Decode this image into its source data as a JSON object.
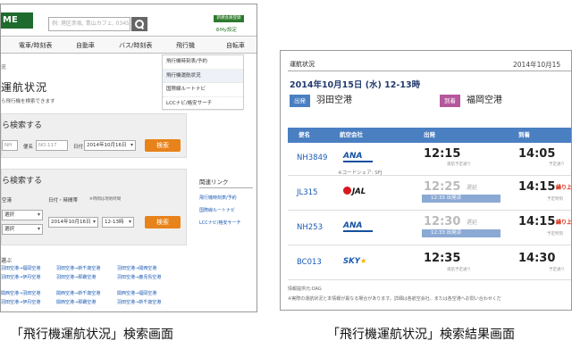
{
  "left": {
    "logo": "ME",
    "search_placeholder": "例: 港区赤坂, 青山カフェ, 0345678901",
    "top_right": "新規会員登録",
    "my_settings": "My設定",
    "nav": [
      "電車/時刻表",
      "自動車",
      "バス/時刻表",
      "飛行機",
      "自転車"
    ],
    "dropdown": [
      "飛行機時刻表/予約",
      "飛行機運航状況",
      "国際線ルートナビ",
      "LCCナビ/格安サーチ"
    ],
    "section_label": "況",
    "page_title": "運航状況",
    "page_sub": "ら飛行機を検索できます",
    "box1": {
      "title": "ら検索する",
      "field1_placeholder": "NH",
      "label_flight": "便名",
      "field2_placeholder": "NO.117",
      "label_date": "日付",
      "date_value": "2014年10月16日",
      "button": "検索"
    },
    "box2": {
      "title": "ら検索する",
      "label_departure": "空港",
      "label_datetime": "日付・時間帯",
      "note": "※時間は現地時間",
      "dep_value": "選択",
      "arr_value": "選択",
      "date_value": "2014年10月16日",
      "time_value": "12-13時",
      "button": "検索"
    },
    "related": {
      "title": "関連リンク",
      "links": [
        "飛行機時刻表/予約",
        "国際線ルートナビ",
        "LCCナビ/格安サーチ"
      ]
    },
    "routes_title": "選ぶ",
    "routes": [
      "羽田空港→福岡空港",
      "羽田空港→新千歳空港",
      "羽田空港→関西空港",
      "羽田空港→伊丹空港",
      "羽田空港→那覇空港",
      "羽田空港→鹿児島空港",
      "関西空港→羽田空港",
      "関西空港→新千歳空港",
      "関西空港→福岡空港",
      "羽田空港→伊丹空港",
      "関西空港→那覇空港",
      "羽田空港→新千歳空港"
    ]
  },
  "right": {
    "section_label": "運航状況",
    "date_top": "2014年10月15",
    "title": "2014年10月15日 (水) 12-13時",
    "dep_badge": "出発",
    "dep_airport": "羽田空港",
    "arr_badge": "到着",
    "arr_airport": "福岡空港",
    "headers": [
      "便名",
      "航空会社",
      "出発",
      "到着"
    ],
    "flights": [
      {
        "no": "NH3849",
        "airline": "ANA",
        "dep": "12:15",
        "dep_note": "運航予定通り",
        "arr": "14:05",
        "arr_note": "予定通り",
        "sub": "※コードシェア: SFJ"
      },
      {
        "no": "JL315",
        "airline": "JAL",
        "dep": "12:25",
        "dep_status": "遅延",
        "dep_bar": "12:33 出発済",
        "arr": "14:15",
        "arr_status": "繰り上",
        "arr_note": "予定時刻"
      },
      {
        "no": "NH253",
        "airline": "ANA",
        "dep": "12:30",
        "dep_status": "遅延",
        "dep_bar": "12:33 出発済",
        "arr": "14:15",
        "arr_status": "繰り上",
        "arr_note": "予定時刻"
      },
      {
        "no": "BC013",
        "airline": "SKY",
        "dep": "12:35",
        "dep_note": "運航予定通り",
        "arr": "14:30",
        "arr_note": "予定通り"
      }
    ],
    "source": "情報提供元:OAG",
    "note": "※実際の運航状況と本情報が異なる場合があります。詳細は各航空会社、または各空港へお問い合わせくだ"
  },
  "captions": {
    "left": "「飛行機運航状況」検索画面",
    "right": "「飛行機運航状況」検索結果画面"
  }
}
